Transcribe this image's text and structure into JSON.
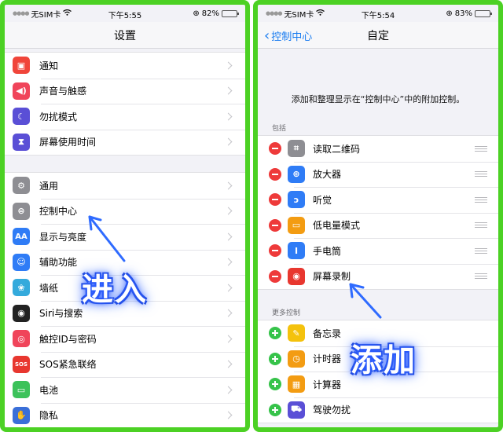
{
  "left": {
    "status": {
      "carrier": "无SIM卡",
      "time": "下午5:55",
      "battery": "82%",
      "battery_level": 0.82
    },
    "title": "设置",
    "group1": [
      {
        "label": "通知",
        "icon": "notification-icon",
        "color": "#f0453a"
      },
      {
        "label": "声音与触感",
        "icon": "sound-icon",
        "color": "#f0445a"
      },
      {
        "label": "勿扰模式",
        "icon": "moon-icon",
        "color": "#5a4fd6"
      },
      {
        "label": "屏幕使用时间",
        "icon": "hourglass-icon",
        "color": "#5a4fd6"
      }
    ],
    "group2": [
      {
        "label": "通用",
        "icon": "gear-icon",
        "color": "#8e8e93"
      },
      {
        "label": "控制中心",
        "icon": "toggles-icon",
        "color": "#8e8e93"
      },
      {
        "label": "显示与亮度",
        "icon": "display-icon",
        "glyph": "AA",
        "color": "#2f7cf6"
      },
      {
        "label": "辅助功能",
        "icon": "accessibility-icon",
        "color": "#2f7cf6"
      },
      {
        "label": "墙纸",
        "icon": "wallpaper-icon",
        "color": "#34aadc"
      },
      {
        "label": "Siri与搜索",
        "icon": "siri-icon",
        "color": "#222222"
      },
      {
        "label": "触控ID与密码",
        "icon": "fingerprint-icon",
        "color": "#f0445a"
      },
      {
        "label": "SOS紧急联络",
        "icon": "sos-icon",
        "glyph": "SOS",
        "color": "#e8372f"
      },
      {
        "label": "电池",
        "icon": "battery-icon",
        "color": "#3cc25a"
      },
      {
        "label": "隐私",
        "icon": "hand-icon",
        "color": "#3a6fd8"
      }
    ],
    "overlay_text": "进入"
  },
  "right": {
    "status": {
      "carrier": "无SIM卡",
      "time": "下午5:54",
      "battery": "83%",
      "battery_level": 0.83
    },
    "back_label": "控制中心",
    "title": "自定",
    "description": "添加和整理显示在“控制中心”中的附加控制。",
    "include_header": "包括",
    "include": [
      {
        "label": "读取二维码",
        "icon": "qr-code-icon",
        "color": "#8e8e93"
      },
      {
        "label": "放大器",
        "icon": "magnifier-icon",
        "color": "#2f7cf6"
      },
      {
        "label": "听觉",
        "icon": "ear-icon",
        "color": "#2f7cf6"
      },
      {
        "label": "低电量模式",
        "icon": "low-power-icon",
        "color": "#f39c12"
      },
      {
        "label": "手电筒",
        "icon": "flashlight-icon",
        "color": "#2f7cf6"
      },
      {
        "label": "屏幕录制",
        "icon": "screen-record-icon",
        "color": "#e8372f"
      }
    ],
    "more_header": "更多控制",
    "more": [
      {
        "label": "备忘录",
        "icon": "notes-icon",
        "color": "#f4c20d"
      },
      {
        "label": "计时器",
        "icon": "timer-icon",
        "color": "#f39c12"
      },
      {
        "label": "计算器",
        "icon": "calculator-icon",
        "color": "#f39c12"
      },
      {
        "label": "驾驶勿扰",
        "icon": "car-icon",
        "color": "#5a4fd6"
      }
    ],
    "overlay_text": "添加"
  }
}
